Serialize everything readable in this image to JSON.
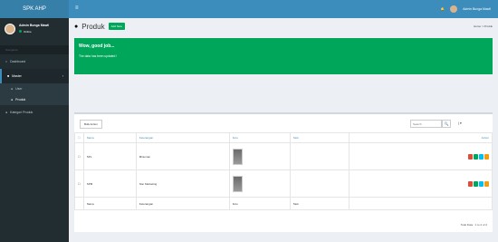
{
  "app": {
    "brand": "SPK AHP"
  },
  "topbar": {
    "bell": "🔔",
    "user_name": "Admin Bunga Mawil",
    "toggle": "≡"
  },
  "sidebar": {
    "user": {
      "name": "Admin Bunga Mawil",
      "status": "Online"
    },
    "header": "Navigation",
    "items": [
      {
        "label": "Dashboard",
        "icon": "home-icon"
      },
      {
        "label": "Master",
        "icon": "file-icon"
      },
      {
        "label": "Kategori Produk",
        "icon": "users-icon"
      }
    ],
    "sub_items": [
      {
        "label": "User",
        "icon": "user-icon"
      },
      {
        "label": "Produk",
        "icon": "users-icon"
      }
    ]
  },
  "header": {
    "title": "Produk",
    "add_button": "Add New",
    "breadcrumb": "Home > Produk"
  },
  "alert": {
    "title": "Wow, good job...",
    "text": "The data has been updated !"
  },
  "toolbar": {
    "bulk_label": "Bulk Action",
    "search_placeholder": "Search",
    "search_icon": "🔍",
    "columns_label": "| ▾"
  },
  "table": {
    "headers": [
      "",
      "Nama",
      "Keterangan",
      "Foto",
      "Stok",
      "Action"
    ],
    "rows": [
      {
        "nama": "SPL",
        "keterangan": "Minuman",
        "stok": ""
      },
      {
        "nama": "SPM",
        "keterangan": "Non Marketing",
        "stok": ""
      }
    ],
    "footer": [
      "",
      "Nama",
      "Keterangan",
      "Foto",
      "Stok",
      ""
    ],
    "total": "Total Data : 1 to 2 of 2"
  },
  "colors": {
    "primary": "#3c8dbc",
    "success": "#00a65a",
    "sidebar": "#222d32"
  }
}
